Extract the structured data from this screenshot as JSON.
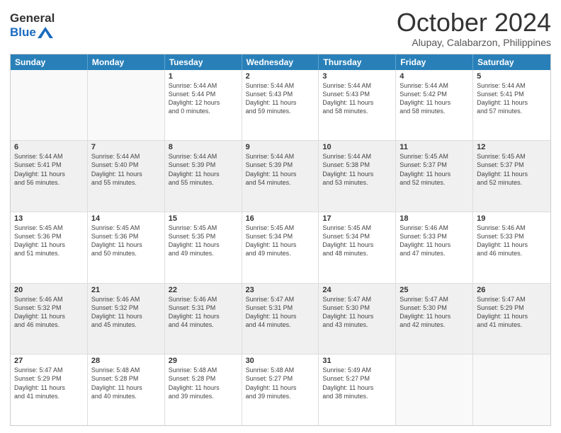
{
  "logo": {
    "line1": "General",
    "line2": "Blue"
  },
  "header": {
    "month": "October 2024",
    "location": "Alupay, Calabarzon, Philippines"
  },
  "weekdays": [
    "Sunday",
    "Monday",
    "Tuesday",
    "Wednesday",
    "Thursday",
    "Friday",
    "Saturday"
  ],
  "rows": [
    [
      {
        "day": "",
        "lines": [],
        "empty": true
      },
      {
        "day": "",
        "lines": [],
        "empty": true
      },
      {
        "day": "1",
        "lines": [
          "Sunrise: 5:44 AM",
          "Sunset: 5:44 PM",
          "Daylight: 12 hours",
          "and 0 minutes."
        ]
      },
      {
        "day": "2",
        "lines": [
          "Sunrise: 5:44 AM",
          "Sunset: 5:43 PM",
          "Daylight: 11 hours",
          "and 59 minutes."
        ]
      },
      {
        "day": "3",
        "lines": [
          "Sunrise: 5:44 AM",
          "Sunset: 5:43 PM",
          "Daylight: 11 hours",
          "and 58 minutes."
        ]
      },
      {
        "day": "4",
        "lines": [
          "Sunrise: 5:44 AM",
          "Sunset: 5:42 PM",
          "Daylight: 11 hours",
          "and 58 minutes."
        ]
      },
      {
        "day": "5",
        "lines": [
          "Sunrise: 5:44 AM",
          "Sunset: 5:41 PM",
          "Daylight: 11 hours",
          "and 57 minutes."
        ]
      }
    ],
    [
      {
        "day": "6",
        "lines": [
          "Sunrise: 5:44 AM",
          "Sunset: 5:41 PM",
          "Daylight: 11 hours",
          "and 56 minutes."
        ],
        "shaded": true
      },
      {
        "day": "7",
        "lines": [
          "Sunrise: 5:44 AM",
          "Sunset: 5:40 PM",
          "Daylight: 11 hours",
          "and 55 minutes."
        ],
        "shaded": true
      },
      {
        "day": "8",
        "lines": [
          "Sunrise: 5:44 AM",
          "Sunset: 5:39 PM",
          "Daylight: 11 hours",
          "and 55 minutes."
        ],
        "shaded": true
      },
      {
        "day": "9",
        "lines": [
          "Sunrise: 5:44 AM",
          "Sunset: 5:39 PM",
          "Daylight: 11 hours",
          "and 54 minutes."
        ],
        "shaded": true
      },
      {
        "day": "10",
        "lines": [
          "Sunrise: 5:44 AM",
          "Sunset: 5:38 PM",
          "Daylight: 11 hours",
          "and 53 minutes."
        ],
        "shaded": true
      },
      {
        "day": "11",
        "lines": [
          "Sunrise: 5:45 AM",
          "Sunset: 5:37 PM",
          "Daylight: 11 hours",
          "and 52 minutes."
        ],
        "shaded": true
      },
      {
        "day": "12",
        "lines": [
          "Sunrise: 5:45 AM",
          "Sunset: 5:37 PM",
          "Daylight: 11 hours",
          "and 52 minutes."
        ],
        "shaded": true
      }
    ],
    [
      {
        "day": "13",
        "lines": [
          "Sunrise: 5:45 AM",
          "Sunset: 5:36 PM",
          "Daylight: 11 hours",
          "and 51 minutes."
        ]
      },
      {
        "day": "14",
        "lines": [
          "Sunrise: 5:45 AM",
          "Sunset: 5:36 PM",
          "Daylight: 11 hours",
          "and 50 minutes."
        ]
      },
      {
        "day": "15",
        "lines": [
          "Sunrise: 5:45 AM",
          "Sunset: 5:35 PM",
          "Daylight: 11 hours",
          "and 49 minutes."
        ]
      },
      {
        "day": "16",
        "lines": [
          "Sunrise: 5:45 AM",
          "Sunset: 5:34 PM",
          "Daylight: 11 hours",
          "and 49 minutes."
        ]
      },
      {
        "day": "17",
        "lines": [
          "Sunrise: 5:45 AM",
          "Sunset: 5:34 PM",
          "Daylight: 11 hours",
          "and 48 minutes."
        ]
      },
      {
        "day": "18",
        "lines": [
          "Sunrise: 5:46 AM",
          "Sunset: 5:33 PM",
          "Daylight: 11 hours",
          "and 47 minutes."
        ]
      },
      {
        "day": "19",
        "lines": [
          "Sunrise: 5:46 AM",
          "Sunset: 5:33 PM",
          "Daylight: 11 hours",
          "and 46 minutes."
        ]
      }
    ],
    [
      {
        "day": "20",
        "lines": [
          "Sunrise: 5:46 AM",
          "Sunset: 5:32 PM",
          "Daylight: 11 hours",
          "and 46 minutes."
        ],
        "shaded": true
      },
      {
        "day": "21",
        "lines": [
          "Sunrise: 5:46 AM",
          "Sunset: 5:32 PM",
          "Daylight: 11 hours",
          "and 45 minutes."
        ],
        "shaded": true
      },
      {
        "day": "22",
        "lines": [
          "Sunrise: 5:46 AM",
          "Sunset: 5:31 PM",
          "Daylight: 11 hours",
          "and 44 minutes."
        ],
        "shaded": true
      },
      {
        "day": "23",
        "lines": [
          "Sunrise: 5:47 AM",
          "Sunset: 5:31 PM",
          "Daylight: 11 hours",
          "and 44 minutes."
        ],
        "shaded": true
      },
      {
        "day": "24",
        "lines": [
          "Sunrise: 5:47 AM",
          "Sunset: 5:30 PM",
          "Daylight: 11 hours",
          "and 43 minutes."
        ],
        "shaded": true
      },
      {
        "day": "25",
        "lines": [
          "Sunrise: 5:47 AM",
          "Sunset: 5:30 PM",
          "Daylight: 11 hours",
          "and 42 minutes."
        ],
        "shaded": true
      },
      {
        "day": "26",
        "lines": [
          "Sunrise: 5:47 AM",
          "Sunset: 5:29 PM",
          "Daylight: 11 hours",
          "and 41 minutes."
        ],
        "shaded": true
      }
    ],
    [
      {
        "day": "27",
        "lines": [
          "Sunrise: 5:47 AM",
          "Sunset: 5:29 PM",
          "Daylight: 11 hours",
          "and 41 minutes."
        ]
      },
      {
        "day": "28",
        "lines": [
          "Sunrise: 5:48 AM",
          "Sunset: 5:28 PM",
          "Daylight: 11 hours",
          "and 40 minutes."
        ]
      },
      {
        "day": "29",
        "lines": [
          "Sunrise: 5:48 AM",
          "Sunset: 5:28 PM",
          "Daylight: 11 hours",
          "and 39 minutes."
        ]
      },
      {
        "day": "30",
        "lines": [
          "Sunrise: 5:48 AM",
          "Sunset: 5:27 PM",
          "Daylight: 11 hours",
          "and 39 minutes."
        ]
      },
      {
        "day": "31",
        "lines": [
          "Sunrise: 5:49 AM",
          "Sunset: 5:27 PM",
          "Daylight: 11 hours",
          "and 38 minutes."
        ]
      },
      {
        "day": "",
        "lines": [],
        "empty": true
      },
      {
        "day": "",
        "lines": [],
        "empty": true
      }
    ]
  ]
}
